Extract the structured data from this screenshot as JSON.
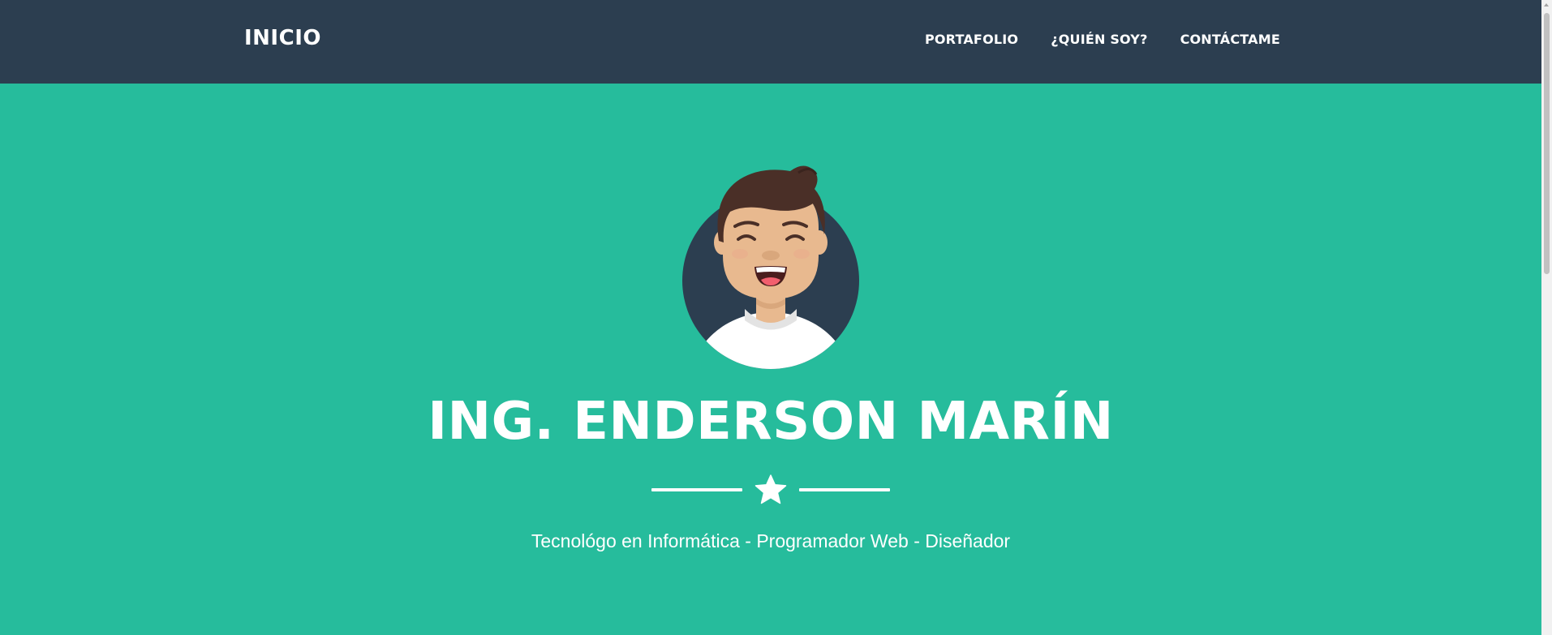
{
  "navbar": {
    "brand": "INICIO",
    "links": [
      {
        "label": "PORTAFOLIO"
      },
      {
        "label": "¿QUIÉN SOY?"
      },
      {
        "label": "CONTÁCTAME"
      }
    ],
    "background": "#2c3e50"
  },
  "masthead": {
    "avatar_icon": "smiling-man-avatar-icon",
    "title": "ING. ENDERSON MARÍN",
    "divider_icon": "star-icon",
    "subtitle": "Tecnológo en Informática - Programador Web - Diseñador",
    "background": "#26bc9c"
  },
  "colors": {
    "primary": "#26bc9c",
    "secondary": "#2c3e50",
    "text": "#ffffff"
  }
}
